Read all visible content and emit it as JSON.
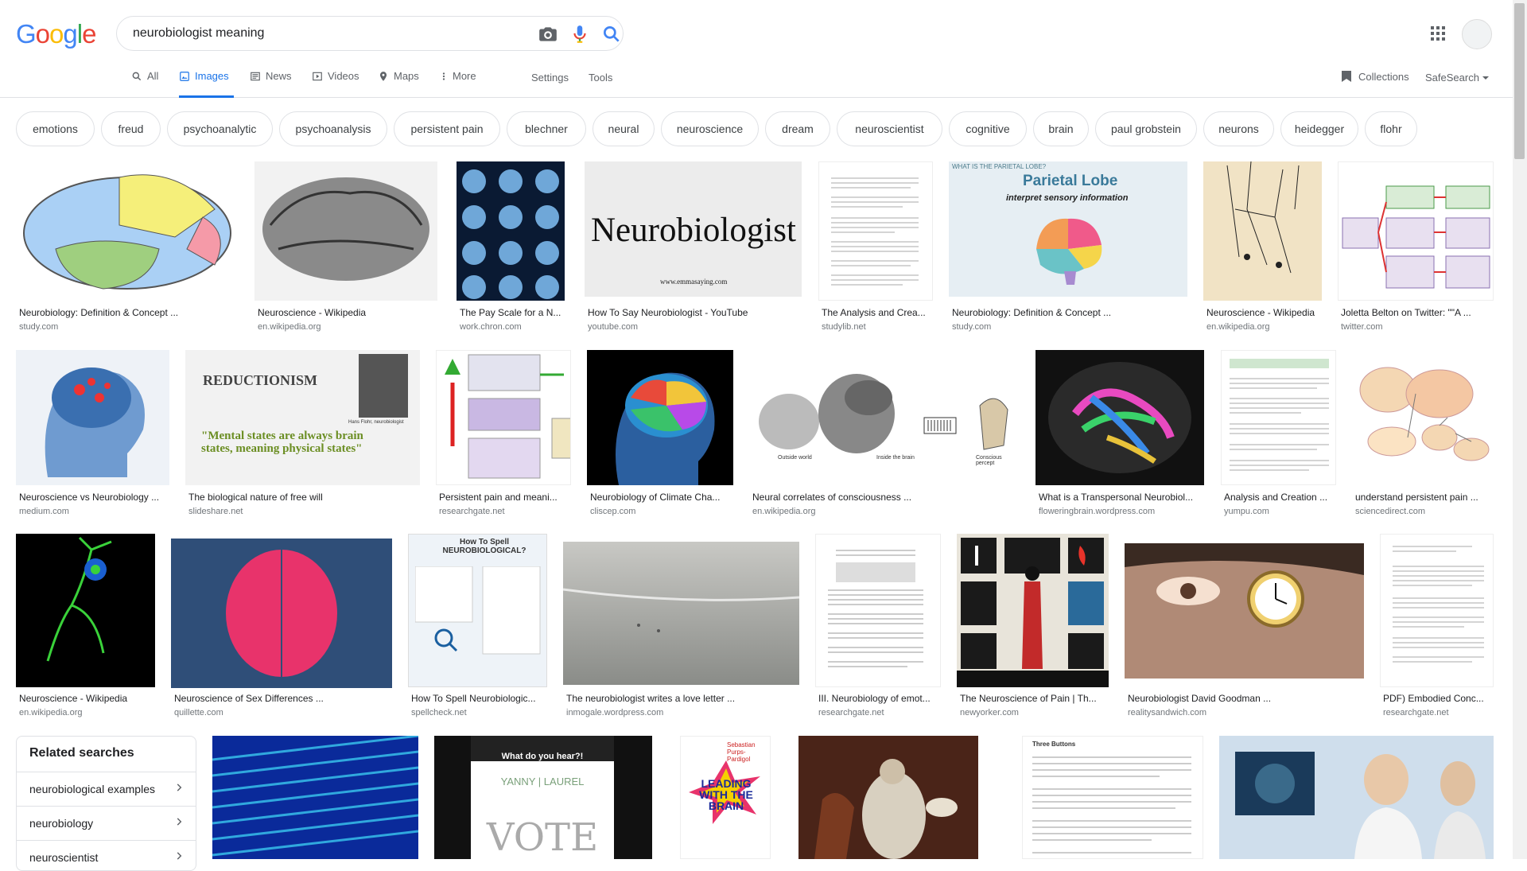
{
  "search": {
    "query": "neurobiologist meaning"
  },
  "tabs": [
    {
      "label": "All",
      "icon": "search-icon"
    },
    {
      "label": "Images",
      "icon": "image-icon"
    },
    {
      "label": "News",
      "icon": "news-icon"
    },
    {
      "label": "Videos",
      "icon": "video-icon"
    },
    {
      "label": "Maps",
      "icon": "map-pin-icon"
    },
    {
      "label": "More",
      "icon": "more-vert-icon"
    }
  ],
  "tools": {
    "settings": "Settings",
    "tools": "Tools",
    "collections": "Collections",
    "safesearch": "SafeSearch"
  },
  "chips": [
    "emotions",
    "freud",
    "psychoanalytic",
    "psychoanalysis",
    "persistent pain",
    "blechner",
    "neural",
    "neuroscience",
    "dream",
    "neuroscientist",
    "cognitive",
    "brain",
    "paul grobstein",
    "neurons",
    "heidegger",
    "flohr"
  ],
  "results": [
    {
      "title": "Neurobiology: Definition & Concept ...",
      "source": "study.com"
    },
    {
      "title": "Neuroscience - Wikipedia",
      "source": "en.wikipedia.org"
    },
    {
      "title": "The Pay Scale for a N...",
      "source": "work.chron.com"
    },
    {
      "title": "How To Say Neurobiologist - YouTube",
      "source": "youtube.com",
      "overlay": "Neurobiologist",
      "overlay2": "www.emmasaying.com"
    },
    {
      "title": "The Analysis and Crea...",
      "source": "studylib.net"
    },
    {
      "title": "Neurobiology: Definition & Concept ...",
      "source": "study.com",
      "overlay": "Parietal Lobe",
      "overlay2": "interpret sensory information",
      "overlay3": "WHAT IS THE PARIETAL LOBE?"
    },
    {
      "title": "Neuroscience - Wikipedia",
      "source": "en.wikipedia.org"
    },
    {
      "title": "Joletta Belton on Twitter: \"\"A ...",
      "source": "twitter.com"
    },
    {
      "title": "Neuroscience vs Neurobiology ...",
      "source": "medium.com"
    },
    {
      "title": "The biological nature of free will",
      "source": "slideshare.net",
      "overlay": "REDUCTIONISM",
      "overlay2": "\"Mental states are always brain states, meaning physical states\"",
      "overlay3": "Hans Flohr, neurobiologist"
    },
    {
      "title": "Persistent pain and meani...",
      "source": "researchgate.net"
    },
    {
      "title": "Neurobiology of Climate Cha...",
      "source": "cliscep.com"
    },
    {
      "title": "Neural correlates of consciousness ...",
      "source": "en.wikipedia.org",
      "overlay": "Outside world",
      "overlay2": "Inside the brain",
      "overlay3": "Conscious percept"
    },
    {
      "title": "What is a Transpersonal Neurobiol...",
      "source": "floweringbrain.wordpress.com"
    },
    {
      "title": "Analysis and Creation ...",
      "source": "yumpu.com"
    },
    {
      "title": "understand persistent pain ...",
      "source": "sciencedirect.com"
    },
    {
      "title": "Neuroscience - Wikipedia",
      "source": "en.wikipedia.org"
    },
    {
      "title": "Neuroscience of Sex Differences ...",
      "source": "quillette.com"
    },
    {
      "title": "How To Spell Neurobiologic...",
      "source": "spellcheck.net",
      "overlay": "How To Spell NEUROBIOLOGICAL?"
    },
    {
      "title": "The neurobiologist writes a love letter ...",
      "source": "inmogale.wordpress.com"
    },
    {
      "title": "III. Neurobiology of emot...",
      "source": "researchgate.net"
    },
    {
      "title": "The Neuroscience of Pain | Th...",
      "source": "newyorker.com"
    },
    {
      "title": "Neurobiologist David Goodman ...",
      "source": "realitysandwich.com"
    },
    {
      "title": "PDF) Embodied Conc...",
      "source": "researchgate.net"
    }
  ],
  "bottom_images": [
    {
      "overlay": ""
    },
    {
      "overlay": "What do you hear?!",
      "overlay2": "YANNY | LAUREL",
      "overlay3": "VOTE"
    },
    {
      "overlay": "LEADING WITH THE BRAIN",
      "overlay2": "Sebastian Purps-Pardigol"
    },
    {
      "overlay": ""
    },
    {
      "overlay": "Three Buttons"
    },
    {
      "overlay": ""
    }
  ],
  "related": {
    "heading": "Related searches",
    "items": [
      "neurobiological examples",
      "neurobiology",
      "neuroscientist"
    ]
  }
}
